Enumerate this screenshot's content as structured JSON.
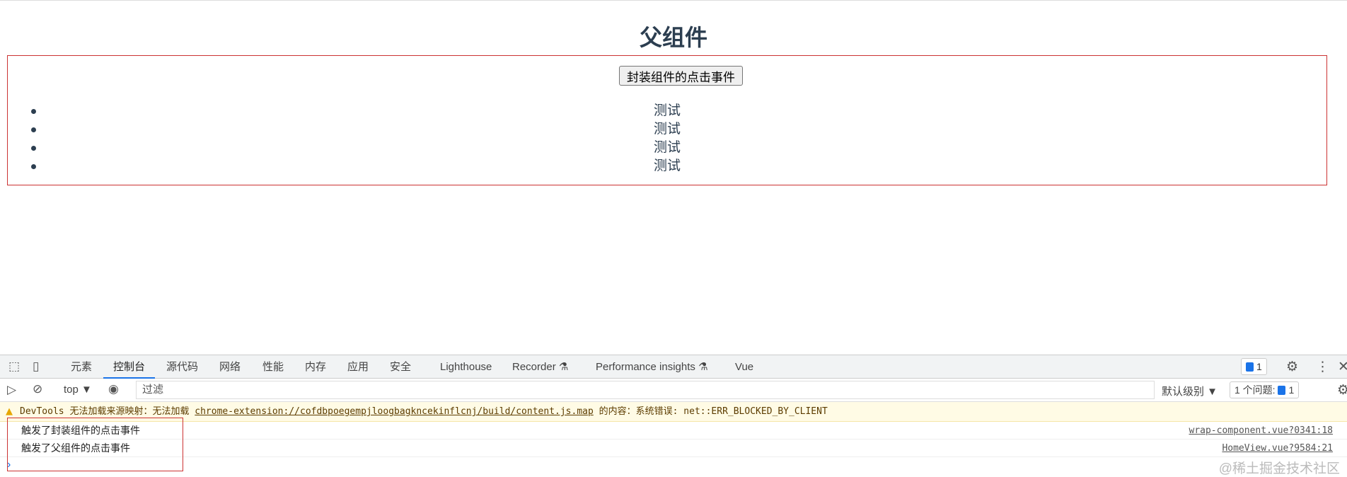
{
  "page": {
    "title": "父组件",
    "button_label": "封装组件的点击事件",
    "items": [
      "测试",
      "测试",
      "测试",
      "测试"
    ]
  },
  "devtools": {
    "tabs": [
      "元素",
      "控制台",
      "源代码",
      "网络",
      "性能",
      "内存",
      "应用",
      "安全",
      "Lighthouse",
      "Recorder",
      "Performance insights",
      "Vue"
    ],
    "active_tab": "控制台",
    "messages_badge": "1",
    "context": "top ▼",
    "filter_placeholder": "过滤",
    "level": "默认级别 ▼",
    "issues_label": "1 个问题:",
    "issues_count": "1",
    "warning": {
      "prefix": "DevTools 无法加载来源映射：无法加载 ",
      "link": "chrome-extension://cofdbpoegempjloogbagkncekinflcnj/build/content.js.map",
      "suffix": " 的内容：系统错误: net::ERR_BLOCKED_BY_CLIENT"
    },
    "logs": [
      {
        "text": "触发了封装组件的点击事件",
        "source": "wrap-component.vue?0341:18"
      },
      {
        "text": "触发了父组件的点击事件",
        "source": "HomeView.vue?9584:21"
      }
    ],
    "prompt": "›"
  },
  "watermark": "@稀土掘金技术社区"
}
